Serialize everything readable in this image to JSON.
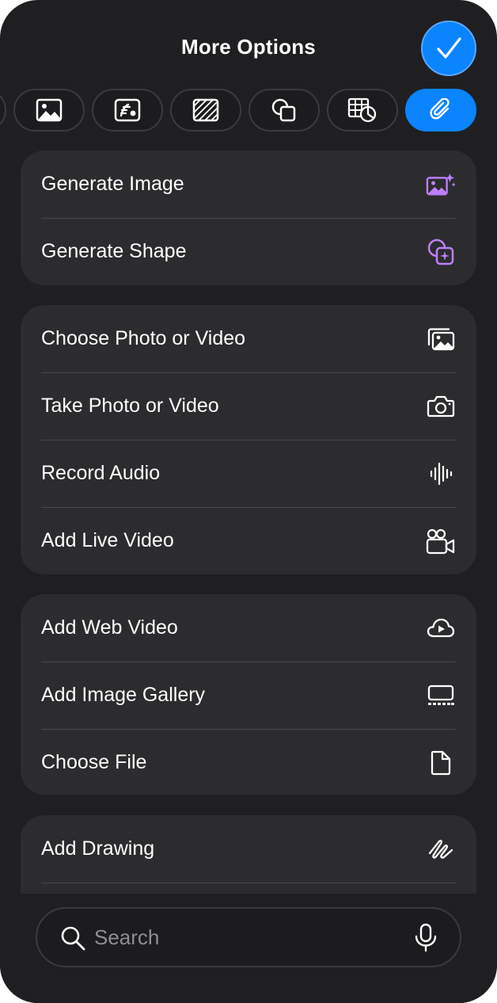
{
  "header": {
    "title": "More Options"
  },
  "toolbar_tabs": [
    {
      "icon": "partial-tab-icon",
      "active": false
    },
    {
      "icon": "photo-icon",
      "active": false
    },
    {
      "icon": "media-gallery-icon",
      "active": false
    },
    {
      "icon": "shape-hatch-icon",
      "active": false
    },
    {
      "icon": "shapes-icon",
      "active": false
    },
    {
      "icon": "table-chart-icon",
      "active": false
    },
    {
      "icon": "paperclip-icon",
      "active": true
    }
  ],
  "groups": [
    {
      "items": [
        {
          "label": "Generate Image",
          "icon": "generate-image-icon"
        },
        {
          "label": "Generate Shape",
          "icon": "generate-shape-icon"
        }
      ]
    },
    {
      "items": [
        {
          "label": "Choose Photo or Video",
          "icon": "photo-library-icon"
        },
        {
          "label": "Take Photo or Video",
          "icon": "camera-icon"
        },
        {
          "label": "Record Audio",
          "icon": "waveform-icon"
        },
        {
          "label": "Add Live Video",
          "icon": "live-video-icon"
        }
      ]
    },
    {
      "items": [
        {
          "label": "Add Web Video",
          "icon": "web-video-icon"
        },
        {
          "label": "Add Image Gallery",
          "icon": "image-gallery-icon"
        },
        {
          "label": "Choose File",
          "icon": "file-icon"
        }
      ]
    },
    {
      "items": [
        {
          "label": "Add Drawing",
          "icon": "drawing-icon"
        }
      ]
    }
  ],
  "search": {
    "placeholder": "Search"
  },
  "colors": {
    "accent": "#0a84ff",
    "ai_purple": "#bf7fff",
    "background": "#1f1f21",
    "group_background": "#2c2c2e"
  }
}
